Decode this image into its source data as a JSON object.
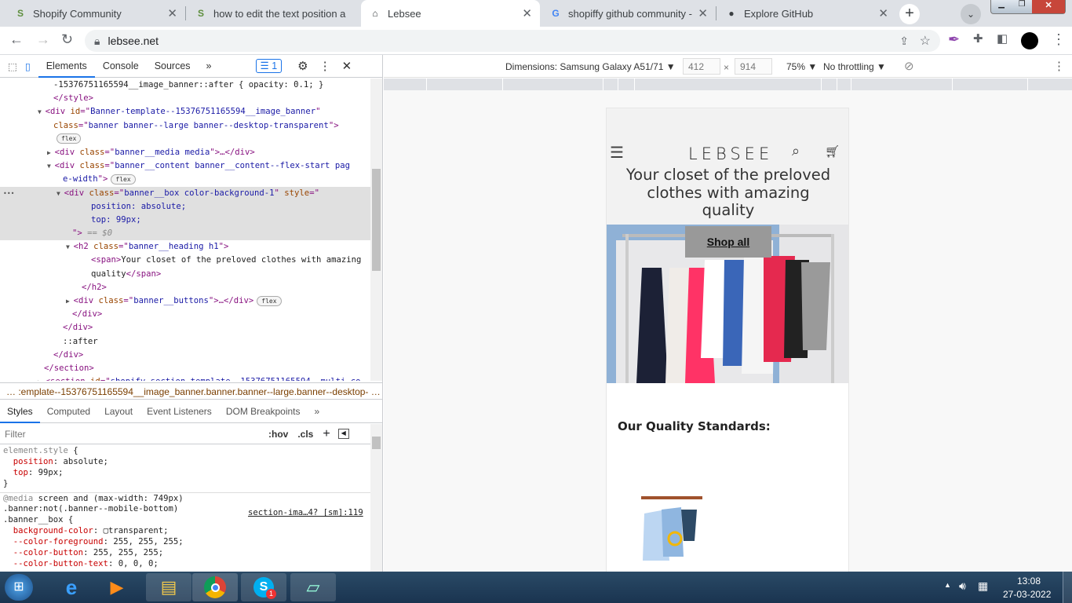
{
  "browser": {
    "tabs": [
      {
        "title": "Shopify Community",
        "icon": "shopify-icon"
      },
      {
        "title": "how to edit the text position a",
        "icon": "shopify-icon"
      },
      {
        "title": "Lebsee",
        "icon": "lebsee-icon"
      },
      {
        "title": "shopiffy github community - G",
        "icon": "google-icon"
      },
      {
        "title": "Explore GitHub",
        "icon": "github-icon"
      }
    ],
    "new_tab": "+",
    "url": "lebsee.net"
  },
  "devtools": {
    "tabs": [
      "Elements",
      "Console",
      "Sources"
    ],
    "more": "»",
    "issues_count": "1",
    "tree": [
      {
        "i": 5,
        "s": [
          [
            "tx",
            "-15376751165594__image_banner::after { opacity: 0.1; }"
          ]
        ]
      },
      {
        "i": 5,
        "s": [
          [
            "tg",
            "</style>"
          ]
        ]
      },
      {
        "i": 4,
        "a": "▼",
        "s": [
          [
            "tg",
            "<div "
          ],
          [
            "at",
            "id"
          ],
          [
            "tg",
            "=\""
          ],
          [
            "av",
            "Banner-template--15376751165594__image_banner"
          ],
          [
            "tg",
            "\""
          ]
        ]
      },
      {
        "i": 5,
        "s": [
          [
            "at",
            "class"
          ],
          [
            "tg",
            "=\""
          ],
          [
            "av",
            "banner banner--large banner--desktop-transparent"
          ],
          [
            "tg",
            "\">"
          ]
        ]
      },
      {
        "i": 5,
        "p": "flex",
        "s": []
      },
      {
        "i": 5,
        "a": "▶",
        "s": [
          [
            "tg",
            "<div "
          ],
          [
            "at",
            "class"
          ],
          [
            "tg",
            "=\""
          ],
          [
            "av",
            "banner__media media"
          ],
          [
            "tg",
            "\">…</div>"
          ]
        ]
      },
      {
        "i": 5,
        "a": "▼",
        "s": [
          [
            "tg",
            "<div "
          ],
          [
            "at",
            "class"
          ],
          [
            "tg",
            "=\""
          ],
          [
            "av",
            "banner__content banner__content--flex-start pag"
          ]
        ]
      },
      {
        "i": 6,
        "p": "flex",
        "s": [
          [
            "av",
            "e-width"
          ],
          [
            "tg",
            "\">"
          ]
        ]
      },
      {
        "i": 6,
        "a": "▼",
        "h": true,
        "s": [
          [
            "tg",
            "<div "
          ],
          [
            "at",
            "class"
          ],
          [
            "tg",
            "=\""
          ],
          [
            "av",
            "banner__box color-background-1"
          ],
          [
            "tg",
            "\" "
          ],
          [
            "at",
            "style"
          ],
          [
            "tg",
            "=\""
          ]
        ]
      },
      {
        "i": 9,
        "h": true,
        "s": [
          [
            "av",
            "position: absolute;"
          ]
        ]
      },
      {
        "i": 9,
        "h": true,
        "s": [
          [
            "av",
            "top: 99px;"
          ]
        ]
      },
      {
        "i": 7,
        "h": true,
        "s": [
          [
            "tg",
            "\">"
          ],
          [
            "cm",
            " == $0"
          ]
        ]
      },
      {
        "i": 7,
        "a": "▼",
        "s": [
          [
            "tg",
            "<h2 "
          ],
          [
            "at",
            "class"
          ],
          [
            "tg",
            "=\""
          ],
          [
            "av",
            "banner__heading h1"
          ],
          [
            "tg",
            "\">"
          ]
        ]
      },
      {
        "i": 9,
        "s": [
          [
            "tg",
            "<span>"
          ],
          [
            "tx",
            "Your closet of the preloved clothes with amazing"
          ]
        ]
      },
      {
        "i": 9,
        "s": [
          [
            "tx",
            "quality"
          ],
          [
            "tg",
            "</span>"
          ]
        ]
      },
      {
        "i": 8,
        "s": [
          [
            "tg",
            "</h2>"
          ]
        ]
      },
      {
        "i": 7,
        "a": "▶",
        "p": "flex",
        "s": [
          [
            "tg",
            "<div "
          ],
          [
            "at",
            "class"
          ],
          [
            "tg",
            "=\""
          ],
          [
            "av",
            "banner__buttons"
          ],
          [
            "tg",
            "\">…</div>"
          ]
        ]
      },
      {
        "i": 7,
        "s": [
          [
            "tg",
            "</div>"
          ]
        ]
      },
      {
        "i": 6,
        "s": [
          [
            "tg",
            "</div>"
          ]
        ]
      },
      {
        "i": 6,
        "s": [
          [
            "tx",
            "::after"
          ]
        ]
      },
      {
        "i": 5,
        "s": [
          [
            "tg",
            "</div>"
          ]
        ]
      },
      {
        "i": 4,
        "s": [
          [
            "tg",
            "</section>"
          ]
        ]
      },
      {
        "i": 4,
        "a": "▶",
        "s": [
          [
            "tg",
            "<section "
          ],
          [
            "at",
            "id"
          ],
          [
            "tg",
            "=\""
          ],
          [
            "av",
            "shopify-section-template--15376751165594__multi_co"
          ]
        ]
      }
    ],
    "breadcrumb": "… :emplate--15376751165594__image_banner.banner.banner--large.banner--desktop- …",
    "style_tabs": [
      "Styles",
      "Computed",
      "Layout",
      "Event Listeners",
      "DOM Breakpoints"
    ],
    "filter_placeholder": "Filter",
    "hov": ":hov",
    "cls": ".cls",
    "plus": "+",
    "rules": [
      [
        [
          "gr",
          "element.style "
        ],
        [
          "sel2",
          "{"
        ]
      ],
      [
        [
          "pn",
          "  position"
        ],
        [
          "pv",
          ": absolute;"
        ]
      ],
      [
        [
          "pn",
          "  top"
        ],
        [
          "pv",
          ": 99px;"
        ]
      ],
      [
        [
          "sel2",
          "}"
        ]
      ],
      [
        [
          "gr",
          "@media"
        ],
        [
          "sel2",
          " screen and (max-width: 749px)"
        ]
      ],
      [
        [
          "sel2",
          ".banner:not(.banner--mobile-bottom)"
        ]
      ],
      [
        [
          "sel2",
          ".banner__box {"
        ]
      ],
      [
        [
          "pn",
          "  background-color"
        ],
        [
          "pv",
          ": ▢transparent;"
        ]
      ],
      [
        [
          "pn",
          "  --color-foreground"
        ],
        [
          "pv",
          ": 255, 255, 255;"
        ]
      ],
      [
        [
          "pn",
          "  --color-button"
        ],
        [
          "pv",
          ": 255, 255, 255;"
        ]
      ],
      [
        [
          "pn",
          "  --color-button-text"
        ],
        [
          "pv",
          ": 0, 0, 0;"
        ]
      ]
    ],
    "rule_source": "section-ima…4? [sm]:119"
  },
  "device_toolbar": {
    "dimensions": "Dimensions: Samsung Galaxy A51/71 ▼",
    "width": "412",
    "x": "×",
    "height": "914",
    "zoom": "75% ▼",
    "throttling": "No throttling ▼"
  },
  "page": {
    "logo": "LEBSEE",
    "headline": "Your closet of the preloved clothes with amazing quality",
    "shop_button": "Shop all",
    "quality_heading": "Our Quality Standards:"
  },
  "taskbar": {
    "time": "13:08",
    "date": "27-03-2022",
    "skype_badge": "1"
  }
}
